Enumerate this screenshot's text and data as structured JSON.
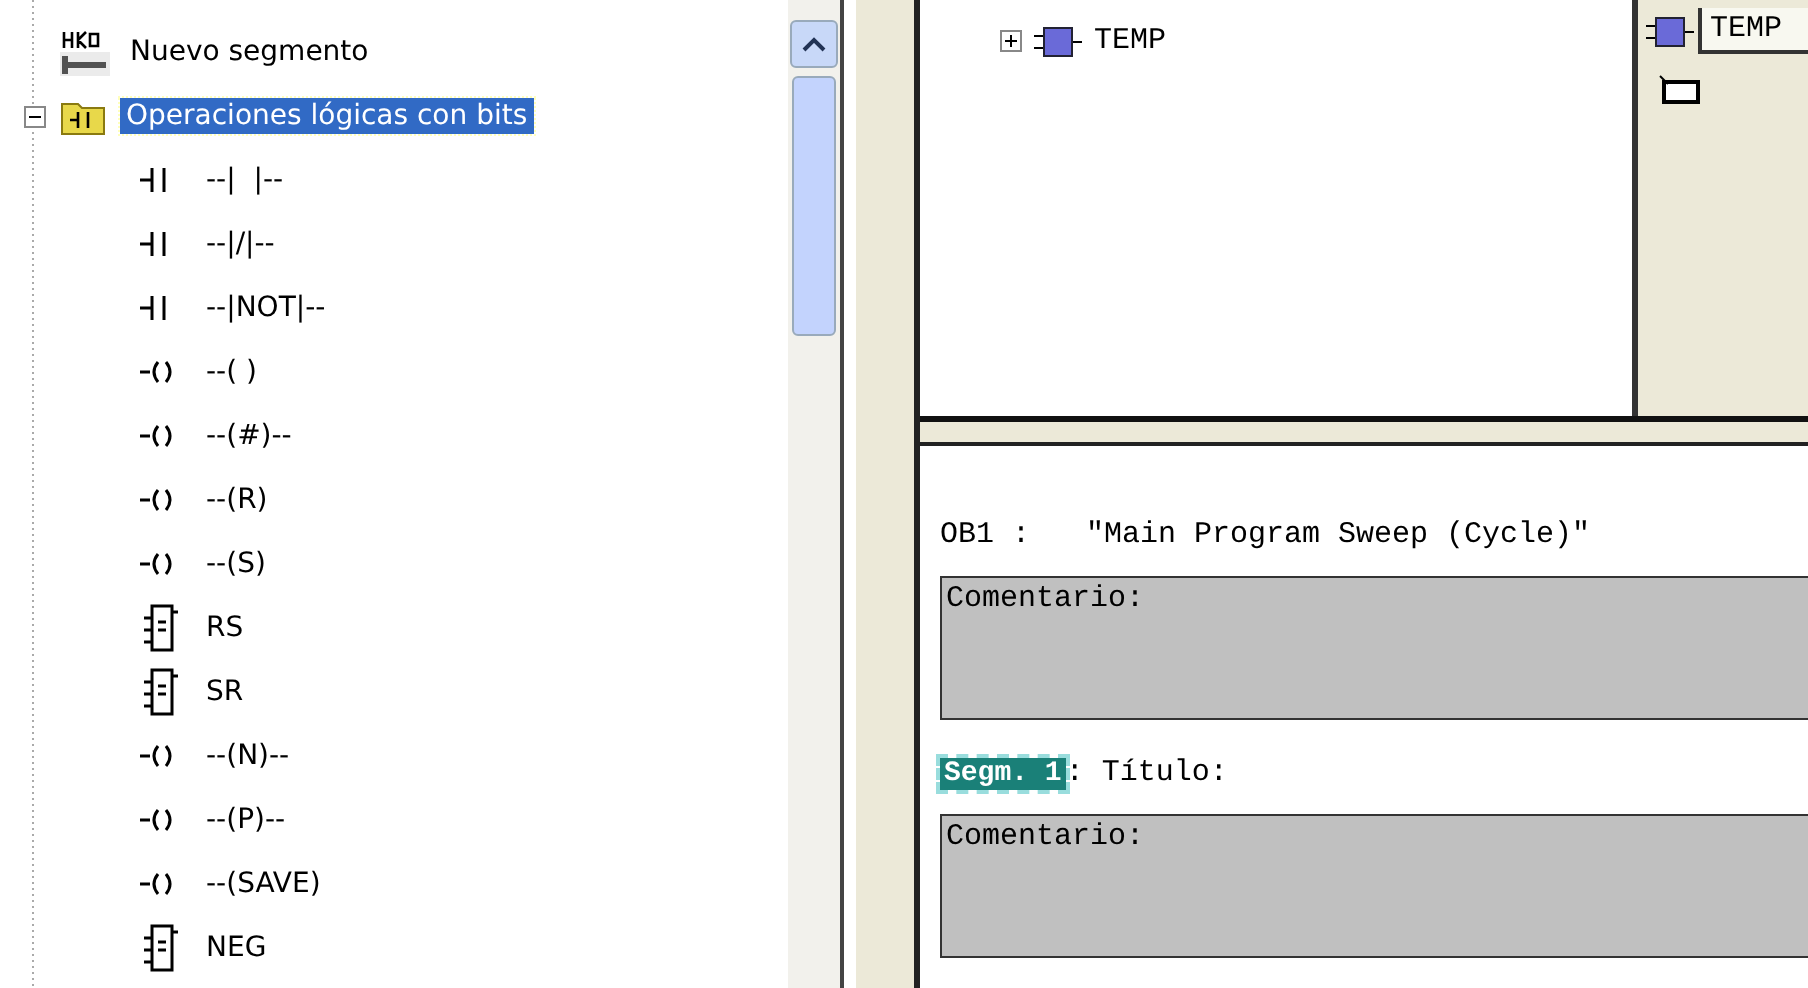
{
  "tree": [
    {
      "label": "Nuevo segmento",
      "kind": "segment",
      "selected": false
    },
    {
      "label": "Operaciones lógicas con bits",
      "kind": "folder",
      "selected": true,
      "expanded": true,
      "children": [
        {
          "label": "--|  |--",
          "kind": "contact",
          "selected": false
        },
        {
          "label": "--|/|--",
          "kind": "contact",
          "selected": false
        },
        {
          "label": "--|NOT|--",
          "kind": "contact",
          "selected": false
        },
        {
          "label": "--( )",
          "kind": "coil",
          "selected": false
        },
        {
          "label": "--(#)--",
          "kind": "coil",
          "selected": false
        },
        {
          "label": "--(R)",
          "kind": "coil",
          "selected": false
        },
        {
          "label": "--(S)",
          "kind": "coil",
          "selected": false
        },
        {
          "label": "RS",
          "kind": "box",
          "selected": false
        },
        {
          "label": "SR",
          "kind": "box",
          "selected": false
        },
        {
          "label": "--(N)--",
          "kind": "coil",
          "selected": false
        },
        {
          "label": "--(P)--",
          "kind": "coil",
          "selected": false
        },
        {
          "label": "--(SAVE)",
          "kind": "coil",
          "selected": false
        },
        {
          "label": "NEG",
          "kind": "box",
          "selected": false
        }
      ]
    }
  ],
  "interface_tree": [
    {
      "label": "TEMP",
      "expanded": false
    }
  ],
  "detail": {
    "name": "TEMP"
  },
  "editor": {
    "block": "OB1 :",
    "block_title": "\"Main Program Sweep (Cycle)\"",
    "block_comment": "Comentario:",
    "networks": [
      {
        "label": "Segm. 1",
        "title": ": Título:",
        "comment": "Comentario:"
      }
    ]
  }
}
